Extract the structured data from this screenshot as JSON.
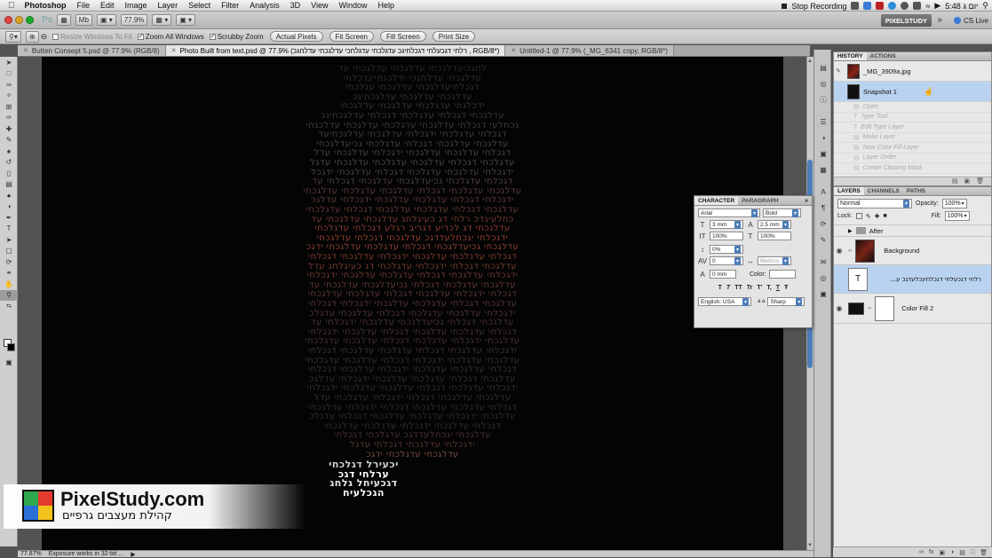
{
  "menubar": {
    "app": "Photoshop",
    "items": [
      "File",
      "Edit",
      "Image",
      "Layer",
      "Select",
      "Filter",
      "Analysis",
      "3D",
      "View",
      "Window",
      "Help"
    ],
    "status": {
      "recording": "Stop Recording",
      "time": "5:48 יום ג"
    }
  },
  "appbar": {
    "zoom": "77.9%",
    "workspace": "PIXELSTUDY",
    "cslive": "CS Live"
  },
  "options": {
    "resize_windows": "Resize Windows To Fit",
    "zoom_all": "Zoom All Windows",
    "scrubby": "Scrubby Zoom",
    "buttons": [
      "Actual Pixels",
      "Fit Screen",
      "Fill Screen",
      "Print Size"
    ]
  },
  "tabs": [
    {
      "label": "Butten Consept 5.psd @ 77.9% (RGB/8)",
      "active": false
    },
    {
      "label": "Photo Built from text.psd @ 77.9% (רלחי דגכעלחי דגכלחיגכ עדגלכחי עדגלחכי עדלגכחי עדלחגכ , RGB/8*)",
      "active": true
    },
    {
      "label": "Untitled-1 @ 77.9% (_MG_6341 copy, RGB/8*)",
      "active": false
    }
  ],
  "canvas": {
    "lines": [
      {
        "text": "לחגכיעדלגכחי עדלגכחי עדלגכחי עד",
        "color": "#2a2a2a"
      },
      {
        "text": "עדלגכחי עדלחגכי ידלכגחייגדכלחי",
        "color": "#2e2e2e"
      },
      {
        "text": "דגכלחיעדלגכחי עדלגכחי עגלכחי",
        "color": "#303030"
      },
      {
        "text": "עדלגכחי עדלגכחי עדלגכחיגכ",
        "color": "#333333"
      },
      {
        "text": "ידכלגחי עדגלכחי עדלגכחי עדלגכחי",
        "color": "#363636"
      },
      {
        "text": "עדלגכחי דגכלחי עדגלכחי דגכלחי עדלגכחיגכ",
        "color": "#3a3a3a"
      },
      {
        "text": "גכחלעי דגכלחי עדלגכחי עדגלכחי עדלגכחי עדלכגחי",
        "color": "#3d3d3d"
      },
      {
        "text": "דגכלחי עדגלכחי ידגכלחי עדלגכחי עדלגכחיעד",
        "color": "#404040"
      },
      {
        "text": "עדלגכחי עדלגכחי דגכלחי עדגלכחי גכיעדלגכחי",
        "color": "#444444"
      },
      {
        "text": "דגכלחי עדלגכחי עדלגכחי ידגכלחי עדלגכחי עדל",
        "color": "#474747"
      },
      {
        "text": "עדגלכחי דגכלחי עדלגכחי עדגלכחי עדלגכחי עדגל",
        "color": "#4a4a4a"
      },
      {
        "text": "ידגכלחי עדלגכחי עדגלכחי דגכלחי עדלגכחי ידגכל",
        "color": "#4c4444"
      },
      {
        "text": "דגכלחי עדגלכחי גכיעדלגכחי עדלגכחי דגכלחי עד",
        "color": "#504040"
      },
      {
        "text": "עדלגכחי עדגלכחי דגכלחי עדלגכחי עדגלכחי עדלגכחי",
        "color": "#553c3a"
      },
      {
        "text": "ידגכלחי דגכלחי עדגלכחי עדלגכחי ידגכלחי עדלגכ",
        "color": "#5c3a36"
      },
      {
        "text": "עדלגכחי דגכלחי עדגלכחי עדלגכחי דגכלחי עדגלכחי",
        "color": "#643a33"
      },
      {
        "text": "כחלעיגדכ רלחי דג כעיגלחג עדלגכחי עדלגכחי עד",
        "color": "#7a3a30"
      },
      {
        "text": "עדלגכחי דג לכריע דגריב רגלע דגכלחי עדגלכחי",
        "color": "#8a3d30"
      },
      {
        "text": "ידגכלחי יגכחלעדדגכ עדלגכחי דגכלחי עדלגכחי",
        "color": "#94402f"
      },
      {
        "text": "עדלגכחי גכיעדלגכחי דגכלחי עדגלכחי עדלגכחי ידגכ",
        "color": "#8f3f31"
      },
      {
        "text": "דגכלחי עדגלכחי עדלגכחי ידגכלחי עדלגכחי דגכלחי",
        "color": "#833b30"
      },
      {
        "text": "עדלגכחי דגכלחי ידגכלחי עדגלכחי דג כעיגלחג עדל",
        "color": "#783a31"
      },
      {
        "text": "ידגכלחי עדלגכחי דגכלחי עדגלכחי עדלגכחי ידגכלחי",
        "color": "#6e3933"
      },
      {
        "text": "עדלגכחי עדגלכחי דגכלחי גכיעדלגכחי עדלגכחי עד",
        "color": "#653834"
      },
      {
        "text": "דגכלחי ידגכלחי עדלגכחי דגכלחי עדגלכחי עדלגכחי",
        "color": "#5e3735"
      },
      {
        "text": "עדלגכחי דגכלחי עדגלכחי עדלגכחי ידגכלחי דגכלחי",
        "color": "#573636"
      },
      {
        "text": "ידגכלחי עדלגכחי עדגלכחי דגכלחי עדלגכחי עדגלכ",
        "color": "#503535"
      },
      {
        "text": "עדלגכחי דגכלחי גכיעדלגכחי עדלגכחי ידגכלחי עד",
        "color": "#4c3434"
      },
      {
        "text": "דגכלחי עדגלכחי עדלגכחי דגכלחי עדלגכחי ידגכלחי",
        "color": "#483232"
      },
      {
        "text": "עדלגכחי ידגכלחי עדגלכחי דגכלחי עדלגכחי עדגלכחי",
        "color": "#443131"
      },
      {
        "text": "ידגכלחי עדלגכחי דגכלחי עדגלכחי עדלגכחי דגכלחי",
        "color": "#423030"
      },
      {
        "text": "עדלגכחי עדגלכחי ידגכלחי דגכלחי עדלגכחי עדגלכחי",
        "color": "#3f2f2f"
      },
      {
        "text": "דגכלחי עדלגכחי עדגלכחי ידגכלחי עדלגכחי דגכלחי",
        "color": "#3d2e2e"
      },
      {
        "text": "עדלגכחי דגכלחי עדגלכחי עדלגכחי ידגכלחי עדלגכ",
        "color": "#3b2d2d"
      },
      {
        "text": "ידגכלחי עדגלכחי דגכלחי עדלגכחי עדגלכחי ידגכלחי",
        "color": "#3a2c2c"
      },
      {
        "text": "עדלגכחי עדלגכחי דגכלחי ידגכלחי עדגלכחי עדל",
        "color": "#382c2c"
      },
      {
        "text": "דגכלחי עדגלכחי עדלגכחי דגכלחי ידגכלחי עדלגכחי",
        "color": "#372b2b"
      },
      {
        "text": "עדלגכחי ידגכלחי עדגלכחי עדלגכחי דגכלחי עדגלכ",
        "color": "#362b2b"
      },
      {
        "text": "דגכלחי עדלגכחי ידגכלחי עדגלכחי עדלגכחי",
        "color": "#3a2c2b"
      },
      {
        "text": "עדלגכחי יגכחלעדדגכ עדגלכחי דגכלחי",
        "color": "#4a3230"
      },
      {
        "text": "ידגכלחי עדלגכחי דגכלחי עדגל",
        "color": "#5a3633"
      },
      {
        "text": "עדלגכחי עדגלכחי ידגכ",
        "color": "#7a4a40"
      },
      {
        "text": "יכעירל דגלכחי",
        "color": "#cfcfcf"
      },
      {
        "text": "ערלחי דגכ",
        "color": "#ffffff"
      },
      {
        "text": "דגכעיחל גלחג",
        "color": "#e8e8e8"
      },
      {
        "text": "הגכלעיח",
        "color": "#ffffff"
      }
    ]
  },
  "history": {
    "tabs": [
      "HISTORY",
      "ACTIONS"
    ],
    "source": "_MG_3909a.jpg",
    "snapshot": "Snapshot 1",
    "steps": [
      "Open",
      "Type Tool",
      "Edit Type Layer",
      "Make Layer",
      "New Color Fill Layer",
      "Layer Order",
      "Create Clipping Mask"
    ]
  },
  "layers": {
    "tabs": [
      "LAYERS",
      "CHANNELS",
      "PATHS"
    ],
    "blend_mode": "Normal",
    "opacity_label": "Opacity:",
    "opacity": "100%",
    "lock_label": "Lock:",
    "fill_label": "Fill:",
    "fill": "100%",
    "items": [
      {
        "name": "After",
        "kind": "group"
      },
      {
        "name": "Background",
        "kind": "image"
      },
      {
        "name": "רלחי דגכעלחי דגכלחיגכלעדגכ ע...",
        "kind": "text"
      },
      {
        "name": "Color Fill 2",
        "kind": "fill"
      }
    ]
  },
  "character": {
    "tabs": [
      "CHARACTER",
      "PARAGRAPH"
    ],
    "font": "Arial",
    "style": "Bold",
    "size": "3 mm",
    "leading": "2.5 mm",
    "vscale": "100%",
    "hscale": "100%",
    "tsume": "0%",
    "tracking": "0",
    "kerning": "Metrics",
    "baseline": "0 mm",
    "color_label": "Color:",
    "language": "English: USA",
    "aa_label": "a a",
    "antialias": "Sharp",
    "style_buttons": [
      "T",
      "T",
      "TT",
      "Tr",
      "T'",
      "T,",
      "T",
      "Ŧ"
    ]
  },
  "logo": {
    "title": "PixelStudy.com",
    "subtitle": "קהילת מעצבים גרפיים"
  },
  "statusbar": {
    "zoom": "77.87%",
    "info": "Exposure works in 32-bit ..."
  }
}
